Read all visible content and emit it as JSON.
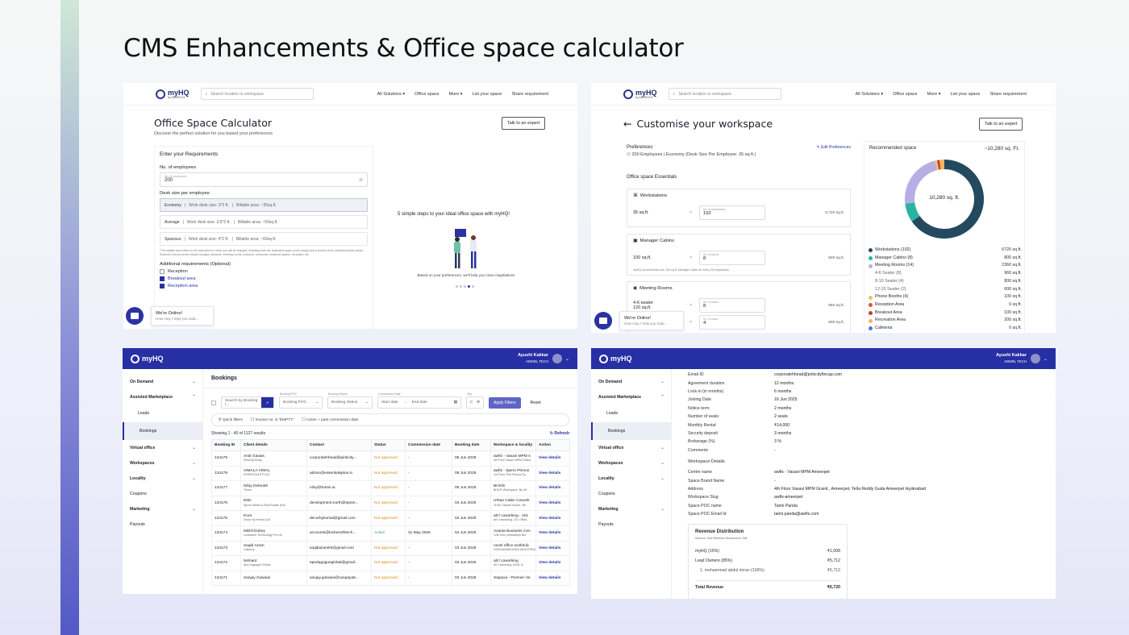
{
  "page": {
    "title": "CMS Enhancements & Office space calculator"
  },
  "nav": {
    "brand": "myHQ",
    "brand_sub": "by ANAROCK",
    "search_placeholder": "Search location or workspace",
    "links": [
      "All Solutions ▾",
      "Office space",
      "More ▾",
      "List your space",
      "Share requirement"
    ],
    "talk_label": "Talk to an expert"
  },
  "calculator": {
    "title": "Office Space Calculator",
    "subtitle": "Discover the perfect solution for you based your preferences",
    "req_heading": "Enter your Requirements",
    "employees_label": "No. of employees",
    "employees_hint": "No. of employees",
    "employees_value": "200",
    "desk_label": "Desk size per employee",
    "options": [
      {
        "name": "Economy",
        "desk": "Work desk size: 3*2 ft.",
        "area": "Billable area: ~35sq.ft."
      },
      {
        "name": "Average",
        "desk": "Work desk size: 3.5*2 ft.",
        "area": "Billable area: ~50sq.ft."
      },
      {
        "name": "Spacious",
        "desk": "Work desk size: 4*2 ft.",
        "area": "Billable area: ~60sq.ft."
      }
    ],
    "note": "*The billable area refers to the total area for which you will be charged, including both the dedicated space you'll occupy and a portion of the shared/common areas. Shared/Common areas include lounges, kitchens, meeting rooms, corridors, restrooms, breakout spaces, reception, etc.",
    "additional_label": "Additional requirements (Optional)",
    "additional": [
      {
        "label": "Reception",
        "checked": false
      },
      {
        "label": "Breakout area",
        "checked": true
      },
      {
        "label": "Reception area",
        "checked": true
      }
    ],
    "steps_title": "5 simple steps to your ideal office space with myHQ!",
    "steps_caption": "Based on your preferences, we'll help you close negotiations"
  },
  "chat": {
    "title": "We're Online!",
    "text": "How may I help you toda..."
  },
  "customise": {
    "title": "Customise your workspace",
    "pref_heading": "Preferences",
    "pref_value": "200 Employees  |  Economy (Desk Size Per Employee: 35 sq.ft.)",
    "edit_label": "Edit Preferences",
    "essentials_heading": "Office space Essentials",
    "workstations": {
      "title": "Workstations",
      "size": "35 sq.ft.",
      "hint": "No. of workstations",
      "count": "192",
      "total": "6,720 sq.ft."
    },
    "cabins": {
      "title": "Manager Cabins",
      "size": "100 sq.ft.",
      "hint": "No. of cabins",
      "count": "8",
      "total": "800 sq.ft.",
      "note": "myHQ recommends one 100 sq.ft. Manager Cabin for every 25 employees"
    },
    "meeting": {
      "title": "Meeting Rooms",
      "rows": [
        {
          "size": "4-6 seater",
          "sub": "120 sq.ft.",
          "hint": "No. of rooms",
          "count": "8",
          "total": "960 sq.ft."
        },
        {
          "size": "",
          "sub": "",
          "hint": "No. of rooms",
          "count": "4",
          "total": "800 sq.ft."
        }
      ]
    },
    "rec_heading": "Recommended space",
    "rec_value": "~10,280 sq. Ft.",
    "donut_label": "10,280 sq. ft.",
    "legend": [
      {
        "label": "Workstations (192)",
        "value": "6720 sq.ft.",
        "color": "#234a5e",
        "sub": false
      },
      {
        "label": "Manager Cabins (8)",
        "value": "800 sq.ft.",
        "color": "#2ab3a2",
        "sub": false
      },
      {
        "label": "Meeting Rooms (14)",
        "value": "2360 sq.ft.",
        "color": "#b8aee6",
        "sub": false
      },
      {
        "label": "4-6 Seater (8)",
        "value": "960 sq.ft.",
        "color": "",
        "sub": true
      },
      {
        "label": "8-10 Seater (4)",
        "value": "800 sq.ft.",
        "color": "",
        "sub": true
      },
      {
        "label": "12-15 Seater (2)",
        "value": "600 sq.ft.",
        "color": "",
        "sub": true
      },
      {
        "label": "Phone Booths (4)",
        "value": "100 sq.ft.",
        "color": "#e8c46a",
        "sub": false
      },
      {
        "label": "Reception Area",
        "value": "0 sq.ft.",
        "color": "#e0543a",
        "sub": false
      },
      {
        "label": "Breakout Area",
        "value": "100 sq.ft.",
        "color": "#c23b3b",
        "sub": false
      },
      {
        "label": "Recreation Area",
        "value": "200 sq.ft.",
        "color": "#f3b65b",
        "sub": false
      },
      {
        "label": "Cafeteria",
        "value": "0 sq.ft.",
        "color": "#5a6ed6",
        "sub": false
      }
    ]
  },
  "admin": {
    "brand": "myHQ",
    "user": "Ayushi Kakkar",
    "role": "ADMIN, TECH",
    "sidebar": [
      {
        "label": "On Demand",
        "chev": "⌄",
        "type": "it"
      },
      {
        "label": "Assisted Marketplace",
        "chev": "⌃",
        "type": "it"
      },
      {
        "label": "Leads",
        "chev": "",
        "type": "subi"
      },
      {
        "label": "Bookings",
        "chev": "",
        "type": "subi active"
      },
      {
        "label": "Virtual office",
        "chev": "⌄",
        "type": "it"
      },
      {
        "label": "Workspaces",
        "chev": "⌄",
        "type": "it"
      },
      {
        "label": "Locality",
        "chev": "⌄",
        "type": "it"
      },
      {
        "label": "Coupons",
        "chev": "",
        "type": "it plain"
      },
      {
        "label": "Marketing",
        "chev": "⌄",
        "type": "it"
      },
      {
        "label": "Payouts",
        "chev": "",
        "type": "it plain"
      }
    ]
  },
  "bookings": {
    "title": "Bookings",
    "search_placeholder": "Search by Booking I...",
    "poc_label": "Booking POC",
    "poc_value": "Booking POC",
    "status_label": "Booking Status",
    "status_value": "Booking Status",
    "commission_label": "Commission Date",
    "start": "Start date",
    "end": "End date",
    "city_label": "City",
    "city_value": "C",
    "apply": "Apply Filters",
    "reset": "Reset",
    "quick": "Quick filters",
    "qf1": "Invoice no. is 'EMPTY'",
    "qf2": "Active + past commission date",
    "showing": "Showing 1 - 40 of 1127 results",
    "refresh": "Refresh",
    "columns": [
      "Booking ID",
      "Client details",
      "Contact",
      "Status",
      "Commission date",
      "Booking date",
      "Workspace & locality",
      "Action"
    ],
    "rows": [
      [
        "134179",
        "Amit Gawas",
        "PinkCityTecap",
        "corporatehhead@pinkcity...",
        "Not approved",
        "-",
        "05 Jun 2025",
        "awfis - Vasavi MPM A",
        "4th Floor Vasavi MPM Grand",
        "View details"
      ],
      [
        "134178",
        "VIMALA VIMAL",
        "ESSENTIALS PLUS",
        "admin@essentialsplus.in",
        "Not approved",
        "-",
        "05 Jun 2025",
        "awfis - Spero Primus",
        "1st Floor, Plot Primus Sq",
        "View details"
      ],
      [
        "134177",
        "Niloy Debnath",
        "Turslo",
        "niloy@tursio.ai",
        "Not approved",
        "-",
        "05 Jun 2025",
        "BHIVE",
        "BHIVE Workspace, No 46",
        "View details"
      ],
      [
        "134176",
        "Nitin",
        "Spree Hotels & Real Estate (Ess",
        "development.north@spree...",
        "Not approved",
        "-",
        "04 Jun 2025",
        "Urban Cabin Cowork",
        "110/8, Tawadi House, 4th",
        "View details"
      ],
      [
        "134175",
        "KoAI",
        "Decor by Kemal & AI",
        "decorbykomal@gmail.com",
        "Not approved",
        "-",
        "04 Jun 2025",
        "alt.f coworking - 101",
        "alt.f coworking, 101 Okhla",
        "View details"
      ],
      [
        "134174",
        "Nikhil Dubey",
        "Luckworth Technology Pvt Ltd",
        "accounts@luckworthtech...",
        "Active",
        "31 May 2026",
        "04 Jun 2025",
        "Avanta Business Cen",
        "12th floor, Ambadeep Bui",
        "View details"
      ],
      [
        "134173",
        "Saqib Azam",
        "Calberry",
        "saqibazamkh@gmail.com",
        "Not approved",
        "-",
        "03 Jun 2025",
        "novel office workhub",
        "DODDANAKKUNDI INDUSTRIAL",
        "View details"
      ],
      [
        "134172",
        "Nishant",
        "Epe Dagogue Global",
        "epedagogueglobal@gmail...",
        "Not approved",
        "-",
        "03 Jun 2025",
        "alt.f coworking",
        "Alt Coworking, A100, A",
        "View details"
      ],
      [
        "134171",
        "Sanjay Gulwani",
        "",
        "sanjay.gulwani@canpaya5...",
        "Not approved",
        "-",
        "03 Jun 2025",
        "Sspacia - Premier Ho",
        "",
        "View details"
      ]
    ]
  },
  "detail": {
    "kv1": [
      [
        "Email ID",
        "corporatehhead@pinkcityfincap.com"
      ],
      [
        "Agreement duration",
        "12 months"
      ],
      [
        "Lock-in (in months)",
        "6 months"
      ],
      [
        "Joining Date",
        "16 Jun 2025"
      ],
      [
        "Notice term",
        "2 months"
      ],
      [
        "Number of seats",
        "2 seats"
      ],
      [
        "Monthly Rental",
        "₹14,000"
      ],
      [
        "Security deposit",
        "3 months"
      ],
      [
        "Brokerage (%)",
        "3 %"
      ],
      [
        "Comments",
        "-"
      ]
    ],
    "ws_heading": "Workspace Details",
    "kv2": [
      [
        "Centre name",
        "awfis - Vasavi MPM Ameerpet"
      ],
      [
        "Space Brand Name",
        "-"
      ],
      [
        "Address",
        "4th Floor Vasavi MPM Grand , Ameerpet, Yella Reddy Guda Ameerpet Hyderabad"
      ],
      [
        "Workspace Slug",
        "awfis-ameerpet"
      ],
      [
        "Space POC name",
        "Tarini Panda"
      ],
      [
        "Space POC Email Id",
        "tarini.panda@awfis.com"
      ]
    ],
    "rev_title": "Revenue Distribution",
    "rev_source": "Source: Not Referral    Subsource: NA",
    "rev_rows": [
      [
        "myHQ (15%)",
        "₹1,008"
      ],
      [
        "Lead Owners (85%)",
        "₹5,712"
      ],
      [
        "1. mohammad abdul imran (100%)",
        "₹5,712"
      ]
    ],
    "total_label": "Total Revenue",
    "total_value": "₹6,720"
  }
}
